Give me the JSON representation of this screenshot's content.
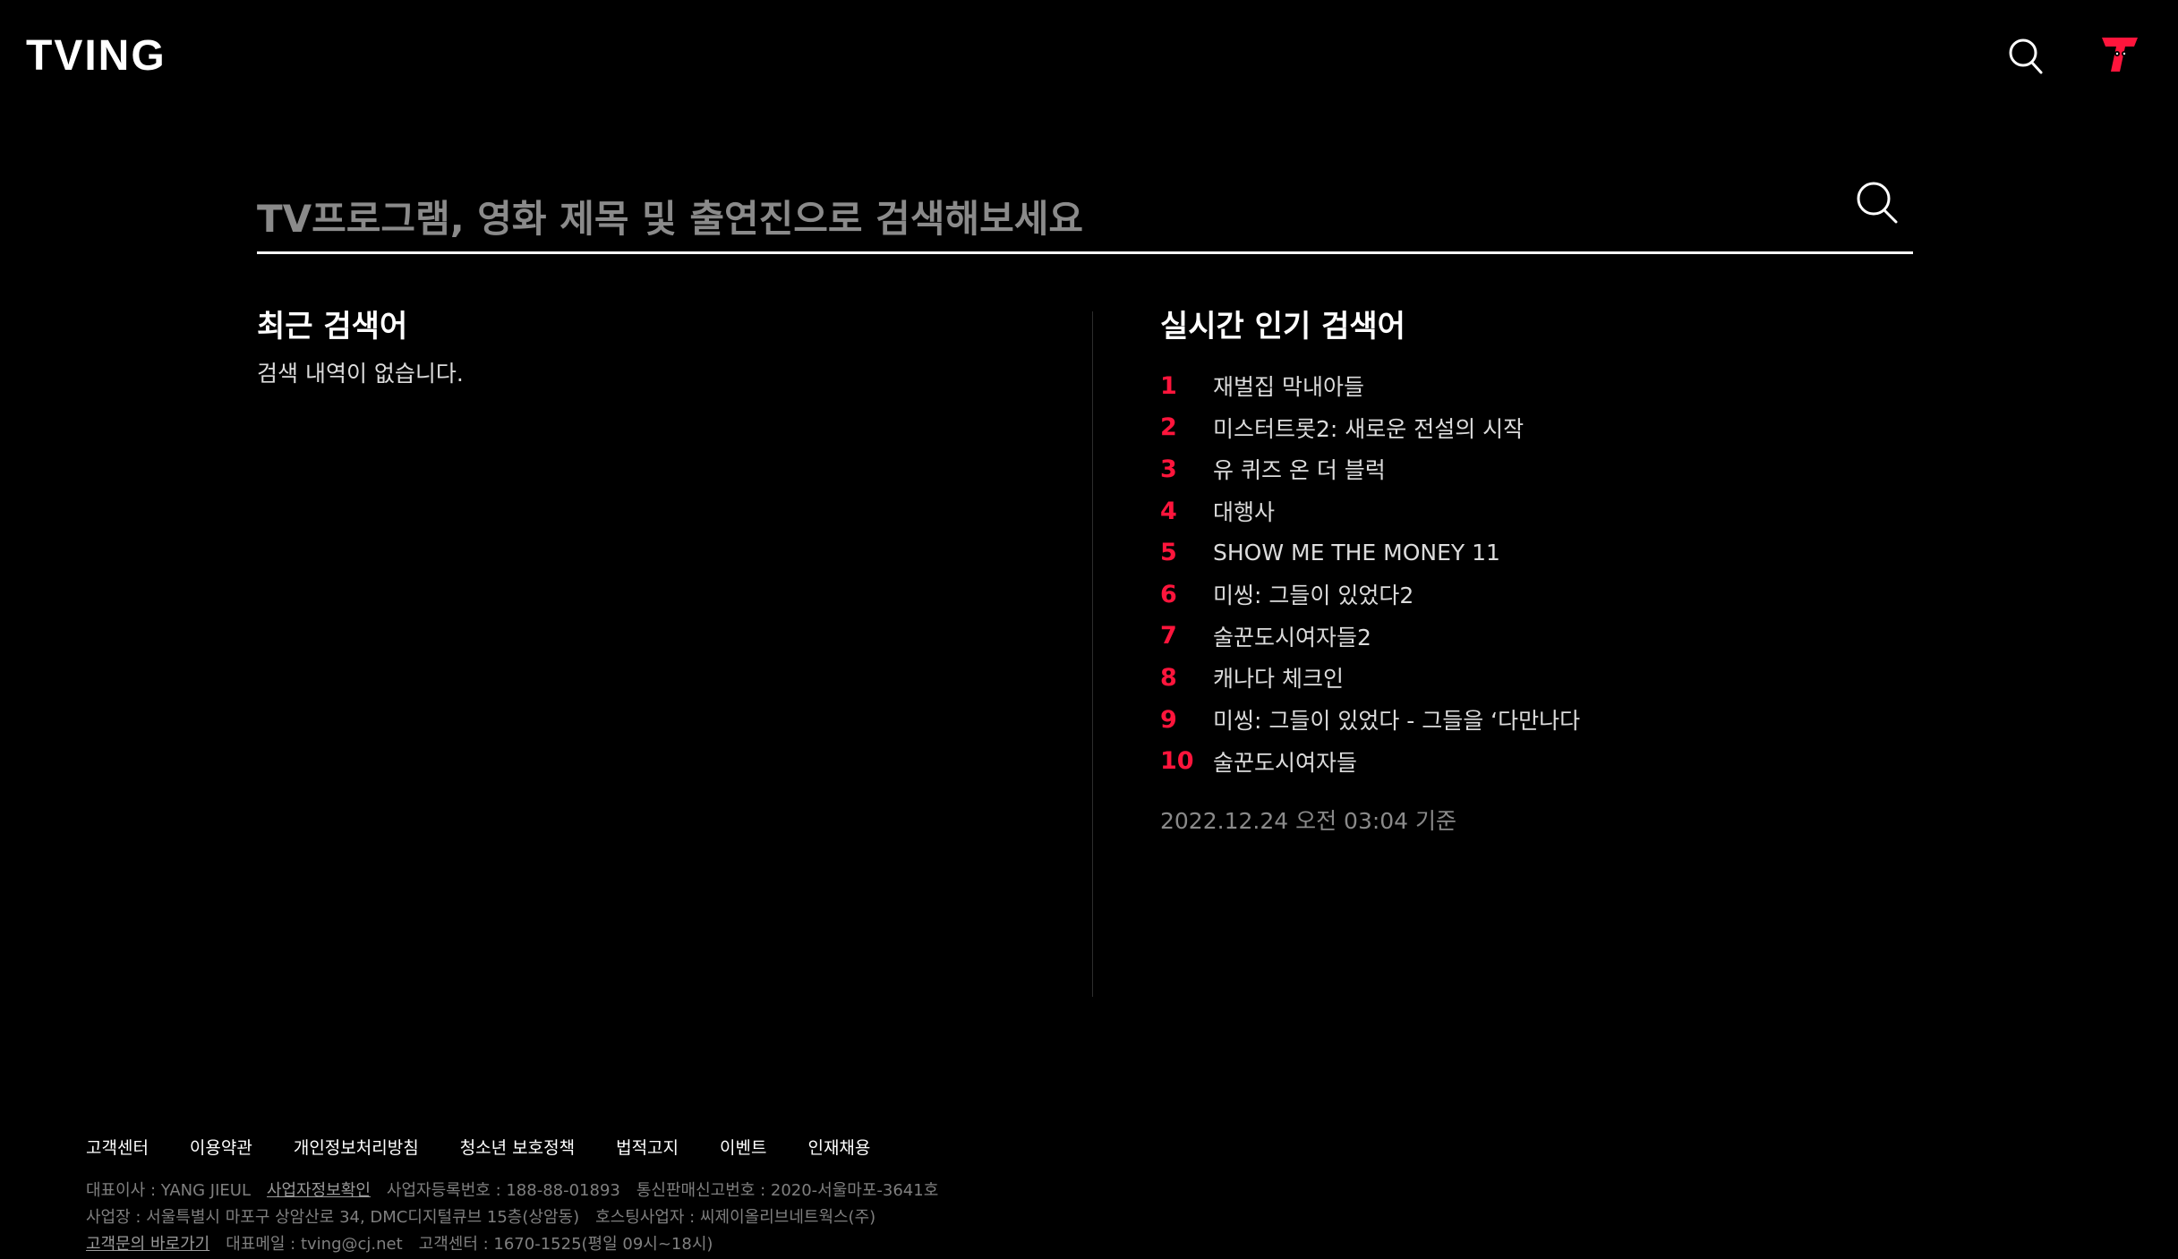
{
  "header": {
    "logo_text": "TVING",
    "search_icon": "search-icon",
    "profile_icon": "profile-avatar-icon"
  },
  "search": {
    "placeholder": "TV프로그램, 영화 제목 및 출연진으로 검색해보세요",
    "value": "",
    "submit_icon": "search-icon"
  },
  "recent": {
    "title": "최근 검색어",
    "empty_message": "검색 내역이 없습니다."
  },
  "popular": {
    "title": "실시간 인기 검색어",
    "items": [
      {
        "rank": "1",
        "title": "재벌집 막내아들"
      },
      {
        "rank": "2",
        "title": "미스터트롯2: 새로운 전설의 시작"
      },
      {
        "rank": "3",
        "title": "유 퀴즈 온 더 블럭"
      },
      {
        "rank": "4",
        "title": "대행사"
      },
      {
        "rank": "5",
        "title": "SHOW ME THE MONEY 11"
      },
      {
        "rank": "6",
        "title": "미씽: 그들이 있었다2"
      },
      {
        "rank": "7",
        "title": "술꾼도시여자들2"
      },
      {
        "rank": "8",
        "title": "캐나다 체크인"
      },
      {
        "rank": "9",
        "title": "미씽: 그들이 있었다 - 그들을 ‘다만나다"
      },
      {
        "rank": "10",
        "title": "술꾼도시여자들"
      }
    ],
    "updated": "2022.12.24 오전 03:04 기준"
  },
  "footer": {
    "links": [
      "고객센터",
      "이용약관",
      "개인정보처리방침",
      "청소년 보호정책",
      "법적고지",
      "이벤트",
      "인재채용"
    ],
    "line1": {
      "ceo": "대표이사 : YANG JIEUL",
      "biz_info_link": "사업자정보확인",
      "biz_reg": "사업자등록번호 : 188-88-01893",
      "mail_order": "통신판매신고번호 : 2020-서울마포-3641호"
    },
    "line2": {
      "address": "사업장 : 서울특별시 마포구 상암산로 34, DMC디지털큐브 15층(상암동)",
      "hosting": "호스팅사업자 : 씨제이올리브네트웍스(주)"
    },
    "line3": {
      "inquiry_link": "고객문의 바로가기",
      "email": "대표메일 : tving@cj.net",
      "cs_center": "고객센터 : 1670-1525(평일 09시~18시)"
    }
  },
  "colors": {
    "background": "#000000",
    "accent": "#ff153c",
    "text": "#ffffff",
    "muted": "#8a8a8a"
  }
}
